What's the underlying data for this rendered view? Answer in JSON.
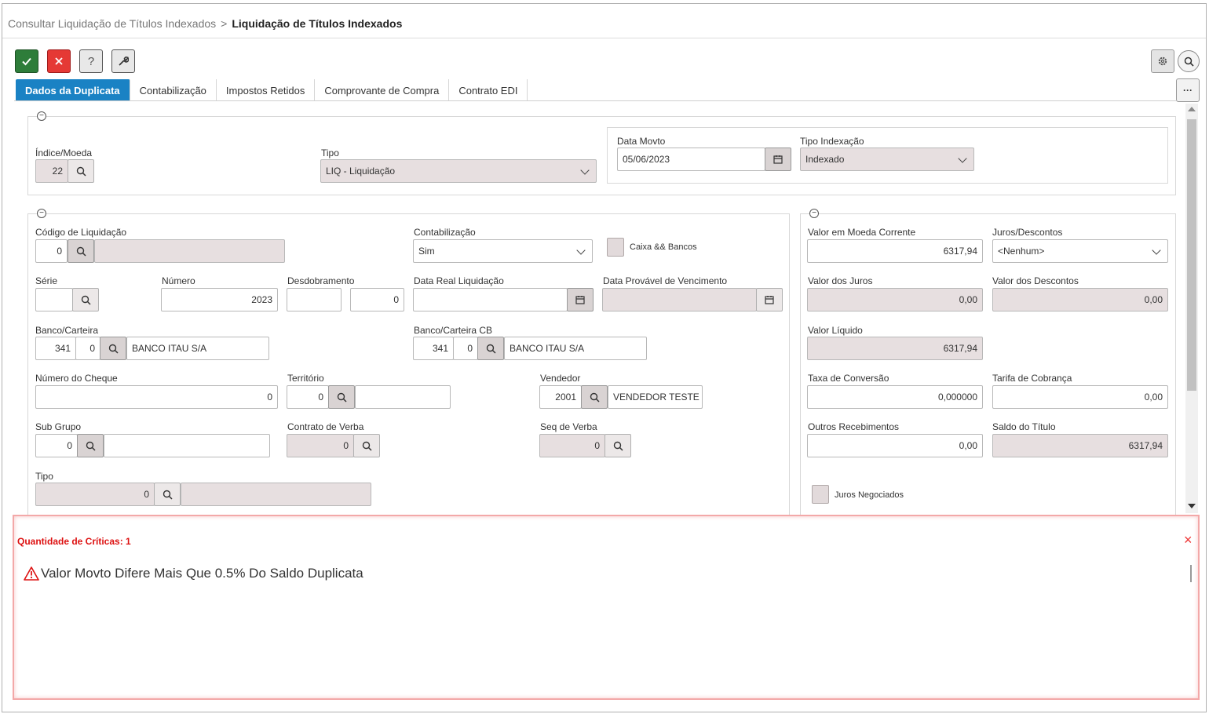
{
  "breadcrumb": {
    "parent": "Consultar Liquidação de Títulos Indexados",
    "separator": ">",
    "current": "Liquidação de Títulos Indexados"
  },
  "tabs": [
    {
      "label": "Dados da Duplicata"
    },
    {
      "label": "Contabilização"
    },
    {
      "label": "Impostos Retidos"
    },
    {
      "label": "Comprovante de Compra"
    },
    {
      "label": "Contrato EDI"
    }
  ],
  "toolbar": {
    "help": "?",
    "more": "···"
  },
  "section1": {
    "indice_moeda": {
      "label": "Índice/Moeda",
      "value": "22"
    },
    "tipo": {
      "label": "Tipo",
      "value": "LIQ - Liquidação"
    },
    "data_movto": {
      "label": "Data Movto",
      "value": "05/06/2023"
    },
    "tipo_indexacao": {
      "label": "Tipo Indexação",
      "value": "Indexado"
    }
  },
  "section2": {
    "codigo_liquidacao": {
      "label": "Código de Liquidação",
      "value": "0",
      "desc": ""
    },
    "contabilizacao": {
      "label": "Contabilização",
      "value": "Sim"
    },
    "caixa_bancos": {
      "label": "Caixa && Bancos"
    },
    "serie": {
      "label": "Série",
      "value": ""
    },
    "numero": {
      "label": "Número",
      "value": "2023"
    },
    "desdobramento": {
      "label": "Desdobramento",
      "value": "",
      "value2": "0"
    },
    "data_real_liquidacao": {
      "label": "Data Real Liquidação",
      "value": ""
    },
    "data_provavel_vencimento": {
      "label": "Data Provável de Vencimento",
      "value": ""
    },
    "banco_carteira": {
      "label": "Banco/Carteira",
      "banco": "341",
      "carteira": "0",
      "nome": "BANCO ITAU S/A"
    },
    "banco_carteira_cb": {
      "label": "Banco/Carteira CB",
      "banco": "341",
      "carteira": "0",
      "nome": "BANCO ITAU S/A"
    },
    "numero_cheque": {
      "label": "Número do Cheque",
      "value": "0"
    },
    "territorio": {
      "label": "Território",
      "value": "0",
      "desc": ""
    },
    "vendedor": {
      "label": "Vendedor",
      "value": "2001",
      "desc": "VENDEDOR TESTE"
    },
    "sub_grupo": {
      "label": "Sub Grupo",
      "value": "0",
      "desc": ""
    },
    "contrato_verba": {
      "label": "Contrato de Verba",
      "value": "0"
    },
    "seq_verba": {
      "label": "Seq de Verba",
      "value": "0"
    },
    "tipo2": {
      "label": "Tipo",
      "value": "0",
      "desc": ""
    }
  },
  "section3": {
    "valor_moeda_corrente": {
      "label": "Valor em Moeda Corrente",
      "value": "6317,94"
    },
    "juros_descontos": {
      "label": "Juros/Descontos",
      "value": "<Nenhum>"
    },
    "valor_juros": {
      "label": "Valor dos Juros",
      "value": "0,00"
    },
    "valor_descontos": {
      "label": "Valor dos Descontos",
      "value": "0,00"
    },
    "valor_liquido": {
      "label": "Valor Líquido",
      "value": "6317,94"
    },
    "taxa_conversao": {
      "label": "Taxa de Conversão",
      "value": "0,000000"
    },
    "tarifa_cobranca": {
      "label": "Tarifa de Cobrança",
      "value": "0,00"
    },
    "outros_recebimentos": {
      "label": "Outros Recebimentos",
      "value": "0,00"
    },
    "saldo_titulo": {
      "label": "Saldo do Título",
      "value": "6317,94"
    },
    "juros_negociados": {
      "label": "Juros Negociados"
    }
  },
  "criticas": {
    "title": "Quantidade de Críticas: 1",
    "message": "Valor Movto Difere Mais Que 0.5% Do Saldo Duplicata",
    "close": "×"
  },
  "colors": {
    "accent": "#1a82c4",
    "ok": "#2e7d3a",
    "cancel": "#e53935",
    "error": "#dd1111",
    "readonly_bg": "#e7dfe0"
  },
  "icons": [
    "check-icon",
    "close-icon",
    "help-icon",
    "wrench-icon",
    "gear-icon",
    "search-icon",
    "calendar-icon",
    "chevron-down-icon",
    "warning-icon",
    "collapse-icon",
    "more-icon"
  ]
}
